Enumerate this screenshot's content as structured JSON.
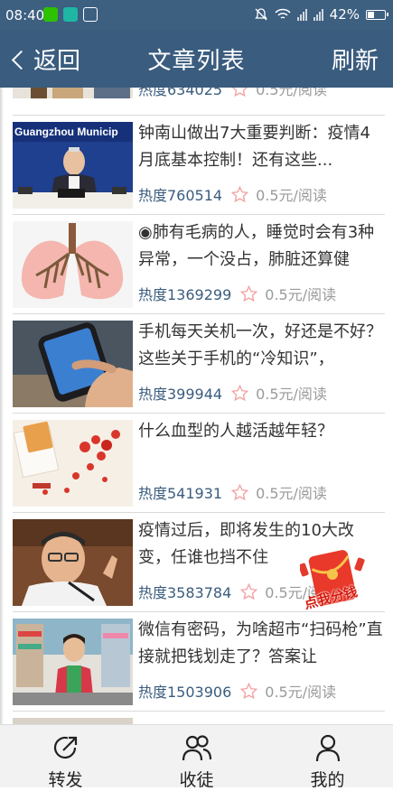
{
  "status_bar": {
    "time": "08:40",
    "battery": "42%",
    "battery_level": 0.42
  },
  "nav": {
    "back_label": "返回",
    "title": "文章列表",
    "refresh_label": "刷新"
  },
  "articles": [
    {
      "title": "",
      "popularity": "热度634025",
      "price": "0.5元/阅读",
      "thumb_text": ""
    },
    {
      "title": "钟南山做出7大重要判断：疫情4月底基本控制！还有这些...",
      "popularity": "热度760514",
      "price": "0.5元/阅读",
      "thumb_text": "Guangzhou Municip"
    },
    {
      "title": "◉肺有毛病的人，睡觉时会有3种异常，一个没占，肺脏还算健",
      "popularity": "热度1369299",
      "price": "0.5元/阅读",
      "thumb_text": ""
    },
    {
      "title": "手机每天关机一次，好还是不好？这些关于手机的“冷知识”，",
      "popularity": "热度399944",
      "price": "0.5元/阅读",
      "thumb_text": ""
    },
    {
      "title": "什么血型的人越活越年轻？",
      "popularity": "热度541931",
      "price": "0.5元/阅读",
      "thumb_text": ""
    },
    {
      "title": "疫情过后，即将发生的10大改变，任谁也挡不住",
      "popularity": "热度3583784",
      "price": "0.5元/阅读",
      "thumb_text": ""
    },
    {
      "title": "微信有密码，为啥超市“扫码枪”直接就把钱划走了？答案让",
      "popularity": "热度1503906",
      "price": "0.5元/阅读",
      "thumb_text": ""
    }
  ],
  "floating_ad": {
    "label": "点我分钱"
  },
  "tabbar": [
    {
      "label": "转发",
      "icon": "share-icon"
    },
    {
      "label": "收徒",
      "icon": "users-icon"
    },
    {
      "label": "我的",
      "icon": "person-icon"
    }
  ],
  "colors": {
    "nav_bg": "#3a5c7e",
    "popularity_text": "#3a5c7e",
    "price_text": "#9a9a9a",
    "star": "#f2a5a5"
  }
}
